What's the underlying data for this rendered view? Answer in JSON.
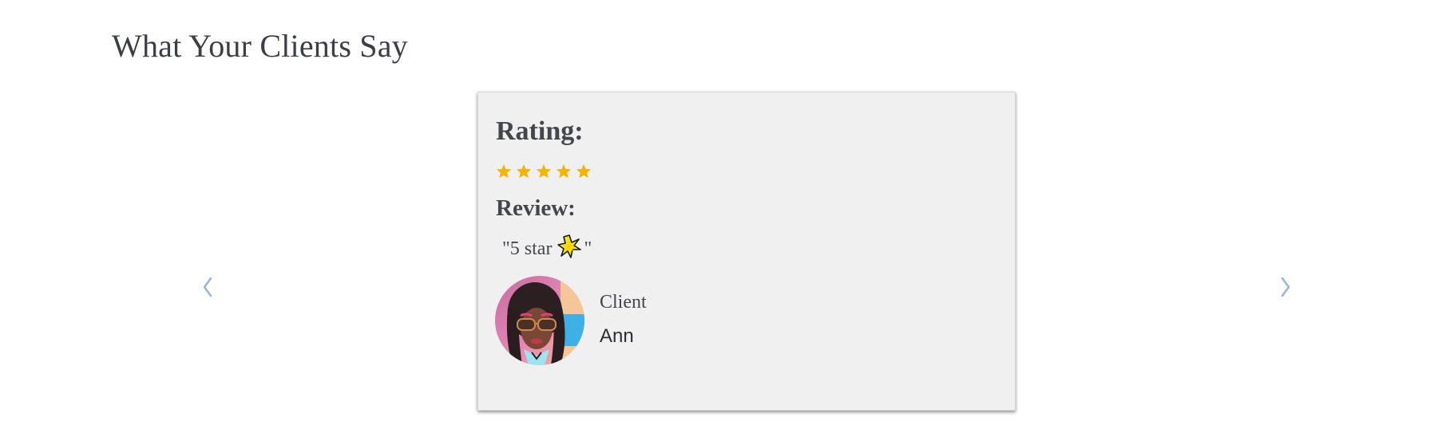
{
  "section": {
    "title": "What Your Clients Say"
  },
  "carousel": {
    "prev_icon": "chevron-left-icon",
    "next_icon": "chevron-right-icon",
    "arrow_color": "#9db7cc"
  },
  "review_card": {
    "rating_label": "Rating:",
    "rating": 5,
    "rating_max": 5,
    "star_color": "#f5b400",
    "review_label": "Review:",
    "review_prefix": "\"5 star",
    "review_icon": "sparkle-star-icon",
    "review_suffix": "\"",
    "client_label": "Client",
    "client_name": "Ann",
    "avatar_icon": "client-avatar"
  }
}
